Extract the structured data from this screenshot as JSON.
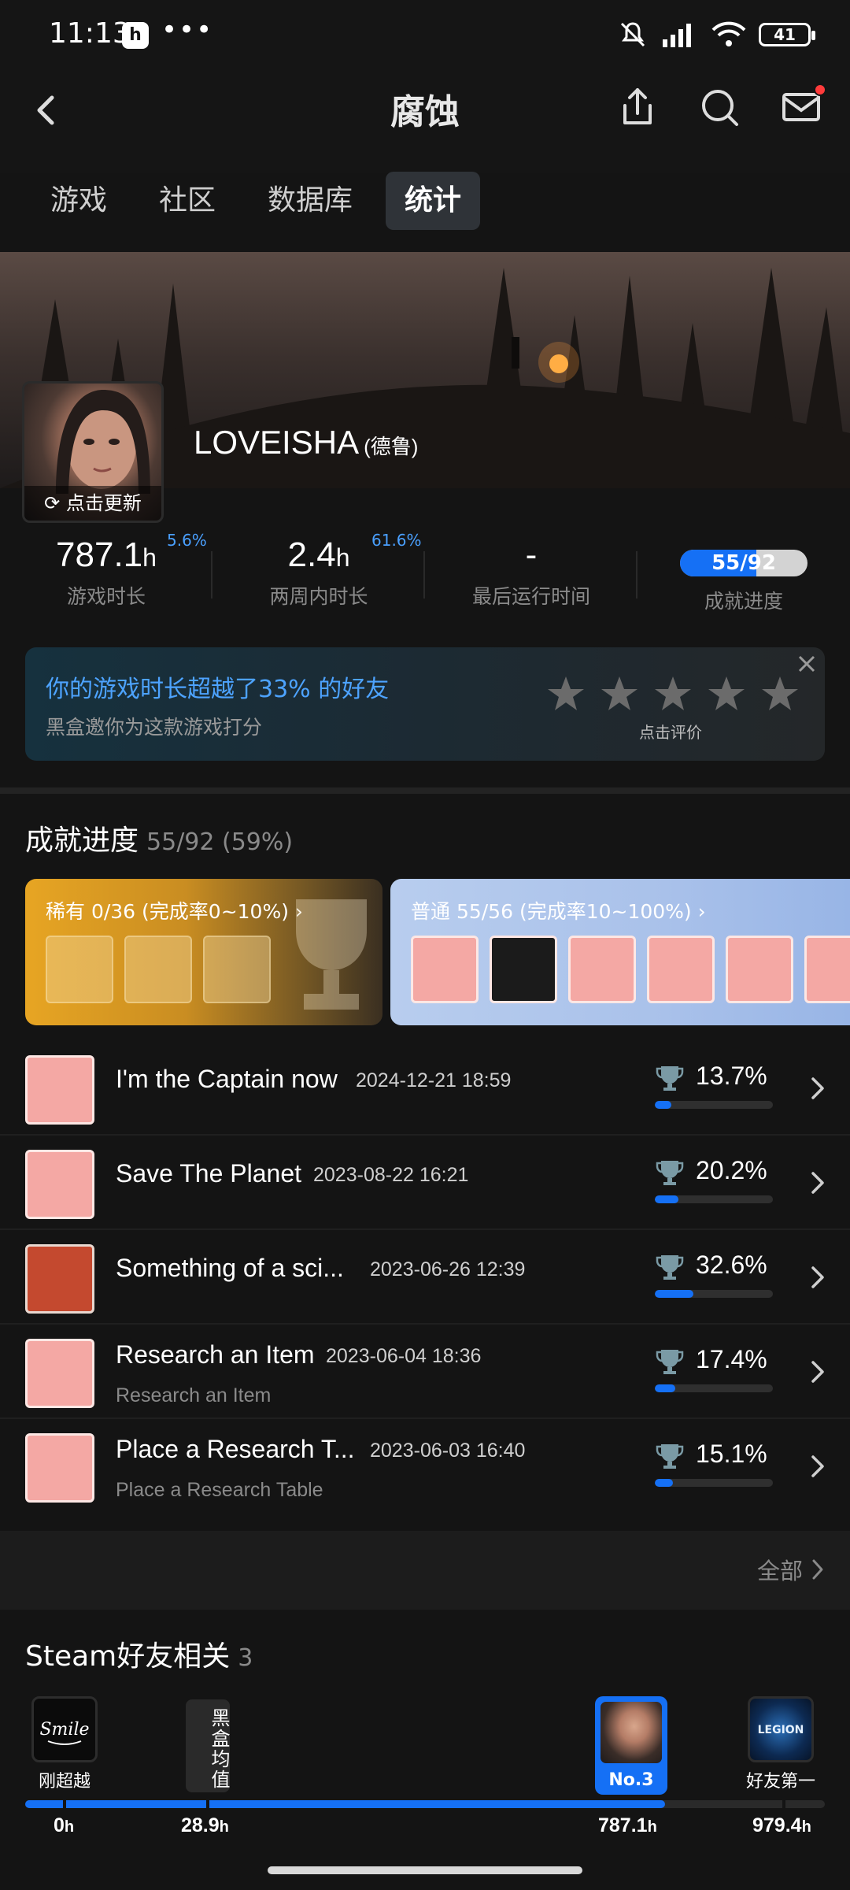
{
  "status_bar": {
    "time": "11:13",
    "app_badge": "h",
    "dots": "•••",
    "battery": "41"
  },
  "header": {
    "title": "腐蚀"
  },
  "tabs": [
    {
      "label": "游戏"
    },
    {
      "label": "社区"
    },
    {
      "label": "数据库"
    },
    {
      "label": "统计",
      "active": true
    }
  ],
  "profile": {
    "username": "LOVEISHA",
    "region": "(德鲁)",
    "refresh_label": "点击更新"
  },
  "stats": {
    "playtime": {
      "value": "787.1",
      "unit": "h",
      "label": "游戏时长",
      "percent": "5.6%"
    },
    "two_week": {
      "value": "2.4",
      "unit": "h",
      "label": "两周内时长",
      "percent": "61.6%"
    },
    "last_run": {
      "value": "-",
      "label": "最后运行时间"
    },
    "achievement": {
      "value": "55/92",
      "label": "成就进度",
      "fraction": 0.598
    }
  },
  "rating_card": {
    "title": "你的游戏时长超越了33% 的好友",
    "subtitle": "黑盒邀你为这款游戏打分",
    "hint": "点击评价",
    "stars": 5
  },
  "achievements_section": {
    "title": "成就进度",
    "summary": "55/92 (59%)",
    "rare_label": "稀有 0/36 (完成率0~10%)",
    "common_label": "普通 55/56 (完成率10~100%)",
    "items": [
      {
        "name": "I'm the Captain now",
        "date": "2024-12-21 18:59",
        "desc": "",
        "percent": "13.7%",
        "fill": 0.137,
        "icon": "astronaut-icon"
      },
      {
        "name": "Save The Planet",
        "date": "2023-08-22 16:21",
        "desc": "",
        "percent": "20.2%",
        "fill": 0.202,
        "icon": "recycle-icon"
      },
      {
        "name": "Something of a sci...",
        "date": "2023-06-26 12:39",
        "desc": "",
        "percent": "32.6%",
        "fill": 0.326,
        "icon": "crosshair-soldier-icon"
      },
      {
        "name": "Research an Item",
        "date": "2023-06-04 18:36",
        "desc": "Research an Item",
        "percent": "17.4%",
        "fill": 0.174,
        "icon": "magnifier-icon"
      },
      {
        "name": "Place a Research T...",
        "date": "2023-06-03 16:40",
        "desc": "Place a Research Table",
        "percent": "15.1%",
        "fill": 0.151,
        "icon": "dragon-icon"
      }
    ],
    "all_label": "全部"
  },
  "friends_section": {
    "title": "Steam好友相关",
    "count": "3",
    "friends": [
      {
        "caption": "刚超越"
      },
      {
        "caption": "No.3"
      },
      {
        "caption": "好友第一"
      }
    ],
    "average_label": "黑盒均值",
    "ticks": [
      {
        "value": "0",
        "unit": "h"
      },
      {
        "value": "28.9",
        "unit": "h"
      },
      {
        "value": "787.1",
        "unit": "h"
      },
      {
        "value": "979.4",
        "unit": "h"
      }
    ],
    "progress_fraction": 0.8
  },
  "colors": {
    "accent": "#1570f5",
    "link_blue": "#4da3ff",
    "alert_red": "#ff3b3b"
  }
}
